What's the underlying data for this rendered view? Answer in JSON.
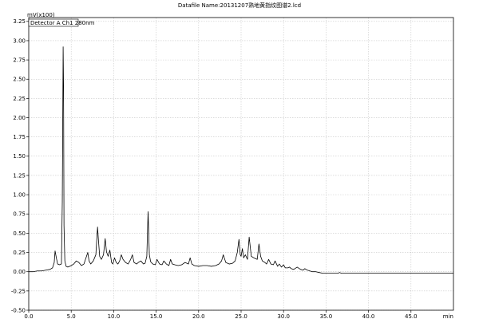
{
  "chart_data": {
    "type": "line",
    "title": "Datafile Name:20131207熟地黄指纹图谱2.lcd",
    "y_unit": "mV(x100)",
    "x_unit": "min",
    "xlim": [
      0,
      50
    ],
    "ylim": [
      -0.5,
      3.3
    ],
    "x_ticks": [
      0.0,
      5.0,
      10.0,
      15.0,
      20.0,
      25.0,
      30.0,
      35.0,
      40.0,
      45.0
    ],
    "x_tick_labels": [
      "0.0",
      "5.0",
      "10.0",
      "15.0",
      "20.0",
      "25.0",
      "30.0",
      "35.0",
      "40.0",
      "45.0"
    ],
    "y_ticks": [
      3.25,
      3.0,
      2.75,
      2.5,
      2.25,
      2.0,
      1.75,
      1.5,
      1.25,
      1.0,
      0.75,
      0.5,
      0.25,
      0.0,
      -0.25,
      -0.5
    ],
    "y_tick_labels": [
      "3.25",
      "3.00",
      "2.75",
      "2.50",
      "2.25",
      "2.00",
      "1.75",
      "1.50",
      "1.25",
      "1.00",
      "0.75",
      "0.50",
      "0.25",
      "0.00",
      "-0.25",
      "-0.50"
    ],
    "grid": true,
    "legend": {
      "label": "Detector A Ch1 280nm",
      "position": "top-left"
    },
    "series": [
      {
        "name": "Detector A Ch1 280nm",
        "color": "#000000",
        "x": [
          0.0,
          0.5,
          1.0,
          1.5,
          2.0,
          2.5,
          2.8,
          3.0,
          3.1,
          3.25,
          3.4,
          3.6,
          3.85,
          3.95,
          4.05,
          4.1,
          4.15,
          4.25,
          4.4,
          4.6,
          4.8,
          5.0,
          5.3,
          5.6,
          5.9,
          6.2,
          6.5,
          6.8,
          6.95,
          7.1,
          7.3,
          7.6,
          7.9,
          8.1,
          8.2,
          8.35,
          8.55,
          8.8,
          9.0,
          9.15,
          9.35,
          9.55,
          9.75,
          9.9,
          10.1,
          10.3,
          10.5,
          10.7,
          10.9,
          11.1,
          11.4,
          11.7,
          12.0,
          12.2,
          12.4,
          12.7,
          12.9,
          13.2,
          13.5,
          13.7,
          13.9,
          14.05,
          14.2,
          14.35,
          14.6,
          14.9,
          15.1,
          15.4,
          15.7,
          15.9,
          16.2,
          16.5,
          16.7,
          16.9,
          17.2,
          17.6,
          18.0,
          18.4,
          18.8,
          19.0,
          19.2,
          19.5,
          20.0,
          20.5,
          21.0,
          21.5,
          22.0,
          22.4,
          22.7,
          22.9,
          23.2,
          23.6,
          24.0,
          24.3,
          24.55,
          24.75,
          24.9,
          25.0,
          25.15,
          25.3,
          25.5,
          25.75,
          25.95,
          26.2,
          26.5,
          26.9,
          27.1,
          27.3,
          27.5,
          27.8,
          28.0,
          28.25,
          28.5,
          28.8,
          29.0,
          29.3,
          29.5,
          29.75,
          30.0,
          30.2,
          30.5,
          30.7,
          30.9,
          31.2,
          31.6,
          32.0,
          32.3,
          32.5,
          32.8,
          33.1,
          33.4,
          33.8,
          34.2,
          34.6,
          35.0,
          35.5,
          36.0,
          36.4,
          36.6,
          36.8,
          37.5,
          38.0,
          39.0,
          40.0,
          41.0,
          42.0,
          43.0,
          44.0,
          45.0,
          46.0,
          47.0,
          48.0,
          49.0,
          50.0
        ],
        "y": [
          0.0,
          0.0,
          0.01,
          0.01,
          0.02,
          0.03,
          0.05,
          0.12,
          0.27,
          0.18,
          0.1,
          0.09,
          0.1,
          0.9,
          2.92,
          2.4,
          0.6,
          0.14,
          0.07,
          0.06,
          0.07,
          0.08,
          0.1,
          0.14,
          0.12,
          0.08,
          0.1,
          0.2,
          0.25,
          0.14,
          0.1,
          0.14,
          0.22,
          0.58,
          0.42,
          0.2,
          0.16,
          0.22,
          0.43,
          0.26,
          0.2,
          0.28,
          0.12,
          0.1,
          0.18,
          0.12,
          0.1,
          0.14,
          0.22,
          0.16,
          0.12,
          0.1,
          0.16,
          0.22,
          0.12,
          0.1,
          0.12,
          0.14,
          0.1,
          0.11,
          0.2,
          0.78,
          0.22,
          0.13,
          0.1,
          0.09,
          0.16,
          0.1,
          0.09,
          0.14,
          0.1,
          0.08,
          0.16,
          0.1,
          0.09,
          0.08,
          0.09,
          0.12,
          0.1,
          0.18,
          0.1,
          0.08,
          0.07,
          0.08,
          0.08,
          0.07,
          0.08,
          0.1,
          0.14,
          0.22,
          0.12,
          0.1,
          0.11,
          0.14,
          0.25,
          0.42,
          0.22,
          0.2,
          0.3,
          0.18,
          0.22,
          0.16,
          0.45,
          0.2,
          0.18,
          0.16,
          0.36,
          0.2,
          0.14,
          0.12,
          0.1,
          0.16,
          0.1,
          0.09,
          0.14,
          0.07,
          0.1,
          0.06,
          0.09,
          0.05,
          0.05,
          0.06,
          0.04,
          0.03,
          0.06,
          0.03,
          0.02,
          0.04,
          0.02,
          0.01,
          0.0,
          0.0,
          -0.01,
          -0.02,
          -0.02,
          -0.02,
          -0.02,
          -0.02,
          -0.01,
          -0.02,
          -0.02,
          -0.02,
          -0.02,
          -0.02,
          -0.02,
          -0.02,
          -0.02,
          -0.02,
          -0.02,
          -0.02,
          -0.02,
          -0.02,
          -0.02,
          -0.02
        ]
      }
    ]
  }
}
